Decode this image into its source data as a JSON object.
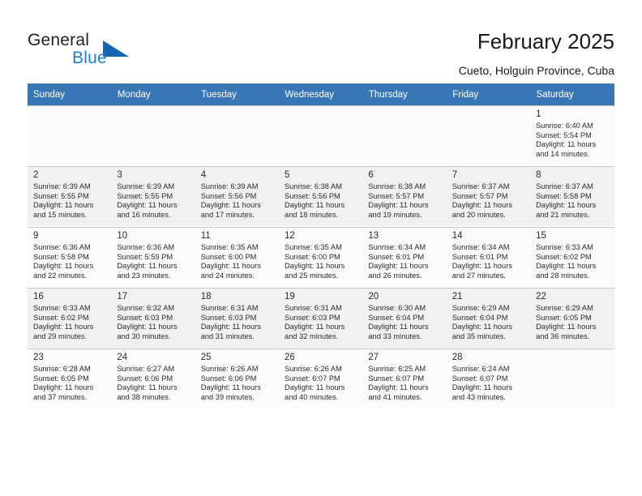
{
  "brand": {
    "name_part1": "General",
    "name_part2": "Blue",
    "triangle_icon": "triangle-icon",
    "color_dark": "#231f20",
    "color_blue": "#1c7fd0"
  },
  "header": {
    "title": "February 2025",
    "subtitle": "Cueto, Holguin Province, Cuba",
    "header_bg": "#3877b5"
  },
  "weekday_headers": [
    "Sunday",
    "Monday",
    "Tuesday",
    "Wednesday",
    "Thursday",
    "Friday",
    "Saturday"
  ],
  "weeks": [
    {
      "days": [
        {
          "num": "",
          "detail": ""
        },
        {
          "num": "",
          "detail": ""
        },
        {
          "num": "",
          "detail": ""
        },
        {
          "num": "",
          "detail": ""
        },
        {
          "num": "",
          "detail": ""
        },
        {
          "num": "",
          "detail": ""
        },
        {
          "num": "1",
          "detail": "Sunrise: 6:40 AM\nSunset: 5:54 PM\nDaylight: 11 hours\nand 14 minutes."
        }
      ]
    },
    {
      "days": [
        {
          "num": "2",
          "detail": "Sunrise: 6:39 AM\nSunset: 5:55 PM\nDaylight: 11 hours\nand 15 minutes."
        },
        {
          "num": "3",
          "detail": "Sunrise: 6:39 AM\nSunset: 5:55 PM\nDaylight: 11 hours\nand 16 minutes."
        },
        {
          "num": "4",
          "detail": "Sunrise: 6:39 AM\nSunset: 5:56 PM\nDaylight: 11 hours\nand 17 minutes."
        },
        {
          "num": "5",
          "detail": "Sunrise: 6:38 AM\nSunset: 5:56 PM\nDaylight: 11 hours\nand 18 minutes."
        },
        {
          "num": "6",
          "detail": "Sunrise: 6:38 AM\nSunset: 5:57 PM\nDaylight: 11 hours\nand 19 minutes."
        },
        {
          "num": "7",
          "detail": "Sunrise: 6:37 AM\nSunset: 5:57 PM\nDaylight: 11 hours\nand 20 minutes."
        },
        {
          "num": "8",
          "detail": "Sunrise: 6:37 AM\nSunset: 5:58 PM\nDaylight: 11 hours\nand 21 minutes."
        }
      ]
    },
    {
      "days": [
        {
          "num": "9",
          "detail": "Sunrise: 6:36 AM\nSunset: 5:58 PM\nDaylight: 11 hours\nand 22 minutes."
        },
        {
          "num": "10",
          "detail": "Sunrise: 6:36 AM\nSunset: 5:59 PM\nDaylight: 11 hours\nand 23 minutes."
        },
        {
          "num": "11",
          "detail": "Sunrise: 6:35 AM\nSunset: 6:00 PM\nDaylight: 11 hours\nand 24 minutes."
        },
        {
          "num": "12",
          "detail": "Sunrise: 6:35 AM\nSunset: 6:00 PM\nDaylight: 11 hours\nand 25 minutes."
        },
        {
          "num": "13",
          "detail": "Sunrise: 6:34 AM\nSunset: 6:01 PM\nDaylight: 11 hours\nand 26 minutes."
        },
        {
          "num": "14",
          "detail": "Sunrise: 6:34 AM\nSunset: 6:01 PM\nDaylight: 11 hours\nand 27 minutes."
        },
        {
          "num": "15",
          "detail": "Sunrise: 6:33 AM\nSunset: 6:02 PM\nDaylight: 11 hours\nand 28 minutes."
        }
      ]
    },
    {
      "days": [
        {
          "num": "16",
          "detail": "Sunrise: 6:33 AM\nSunset: 6:02 PM\nDaylight: 11 hours\nand 29 minutes."
        },
        {
          "num": "17",
          "detail": "Sunrise: 6:32 AM\nSunset: 6:03 PM\nDaylight: 11 hours\nand 30 minutes."
        },
        {
          "num": "18",
          "detail": "Sunrise: 6:31 AM\nSunset: 6:03 PM\nDaylight: 11 hours\nand 31 minutes."
        },
        {
          "num": "19",
          "detail": "Sunrise: 6:31 AM\nSunset: 6:03 PM\nDaylight: 11 hours\nand 32 minutes."
        },
        {
          "num": "20",
          "detail": "Sunrise: 6:30 AM\nSunset: 6:04 PM\nDaylight: 11 hours\nand 33 minutes."
        },
        {
          "num": "21",
          "detail": "Sunrise: 6:29 AM\nSunset: 6:04 PM\nDaylight: 11 hours\nand 35 minutes."
        },
        {
          "num": "22",
          "detail": "Sunrise: 6:29 AM\nSunset: 6:05 PM\nDaylight: 11 hours\nand 36 minutes."
        }
      ]
    },
    {
      "days": [
        {
          "num": "23",
          "detail": "Sunrise: 6:28 AM\nSunset: 6:05 PM\nDaylight: 11 hours\nand 37 minutes."
        },
        {
          "num": "24",
          "detail": "Sunrise: 6:27 AM\nSunset: 6:06 PM\nDaylight: 11 hours\nand 38 minutes."
        },
        {
          "num": "25",
          "detail": "Sunrise: 6:26 AM\nSunset: 6:06 PM\nDaylight: 11 hours\nand 39 minutes."
        },
        {
          "num": "26",
          "detail": "Sunrise: 6:26 AM\nSunset: 6:07 PM\nDaylight: 11 hours\nand 40 minutes."
        },
        {
          "num": "27",
          "detail": "Sunrise: 6:25 AM\nSunset: 6:07 PM\nDaylight: 11 hours\nand 41 minutes."
        },
        {
          "num": "28",
          "detail": "Sunrise: 6:24 AM\nSunset: 6:07 PM\nDaylight: 11 hours\nand 43 minutes."
        },
        {
          "num": "",
          "detail": ""
        }
      ]
    }
  ]
}
